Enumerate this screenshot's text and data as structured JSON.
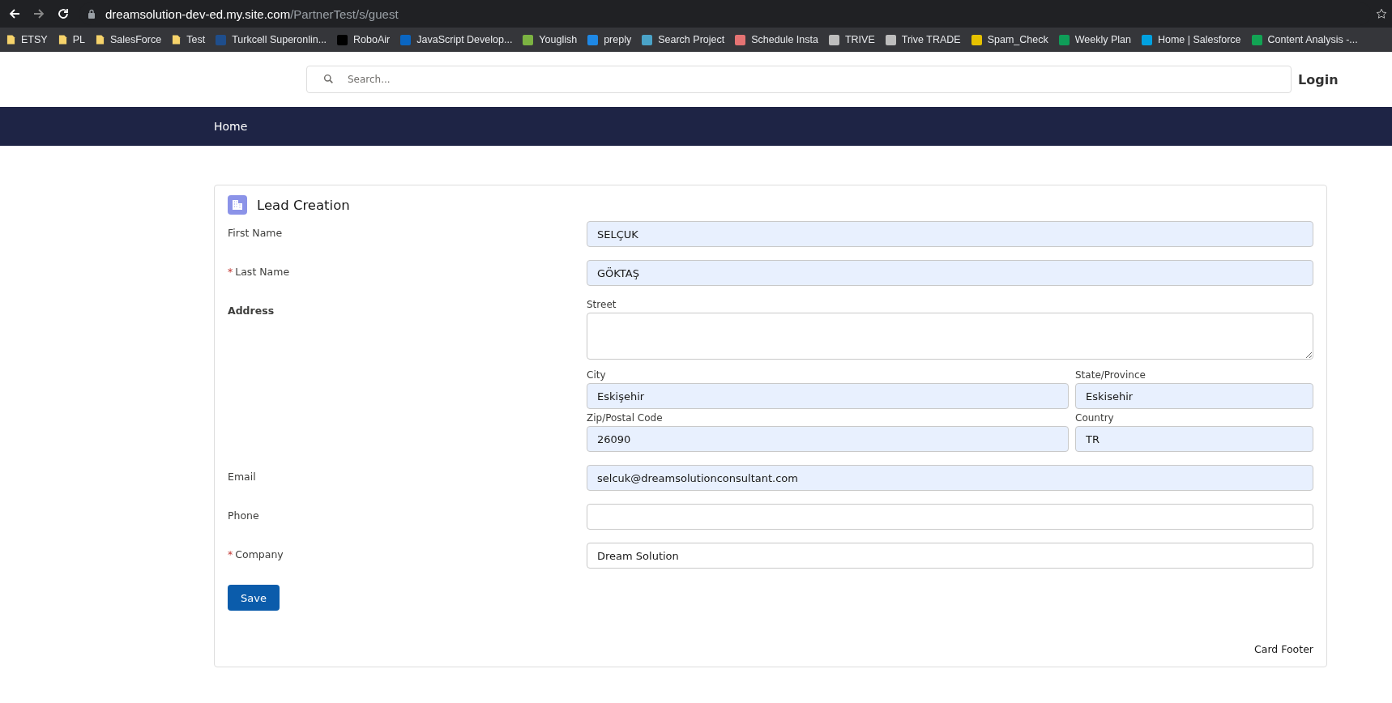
{
  "browser": {
    "url_host": "dreamsolution-dev-ed.my.site.com",
    "url_path": "/PartnerTest/s/guest",
    "bookmarks": [
      {
        "label": "ETSY",
        "kind": "folder"
      },
      {
        "label": "PL",
        "kind": "folder"
      },
      {
        "label": "SalesForce",
        "kind": "folder"
      },
      {
        "label": "Test",
        "kind": "folder"
      },
      {
        "label": "Turkcell Superonlin...",
        "kind": "site",
        "color": "#1f4e8c"
      },
      {
        "label": "RoboAir",
        "kind": "site",
        "color": "#000000"
      },
      {
        "label": "JavaScript Develop...",
        "kind": "site",
        "color": "#0a66c2"
      },
      {
        "label": "Youglish",
        "kind": "site",
        "color": "#7cb342"
      },
      {
        "label": "preply",
        "kind": "site",
        "color": "#1e88e5"
      },
      {
        "label": "Search Project",
        "kind": "site",
        "color": "#4aa3c8"
      },
      {
        "label": "Schedule Insta",
        "kind": "site",
        "color": "#e57373"
      },
      {
        "label": "TRIVE",
        "kind": "site",
        "color": "#bdbdbd"
      },
      {
        "label": "Trive TRADE",
        "kind": "site",
        "color": "#bdbdbd"
      },
      {
        "label": "Spam_Check",
        "kind": "site",
        "color": "#e6c200"
      },
      {
        "label": "Weekly Plan",
        "kind": "site",
        "color": "#0f9d58"
      },
      {
        "label": "Home | Salesforce",
        "kind": "site",
        "color": "#00a1e0"
      },
      {
        "label": "Content Analysis -...",
        "kind": "site",
        "color": "#12a454"
      }
    ]
  },
  "header": {
    "search": {
      "placeholder": "Search..."
    },
    "login": "Login"
  },
  "nav": {
    "items": [
      {
        "label": "Home"
      }
    ]
  },
  "card": {
    "title": "Lead Creation",
    "required_mark": "*",
    "footer": "Card Footer",
    "save": "Save",
    "fields": [
      {
        "kind": "text",
        "label": "First Name",
        "required": false,
        "value": "SELÇUK",
        "autofilled": true
      },
      {
        "kind": "text",
        "label": "Last Name",
        "required": true,
        "value": "GÖKTAŞ",
        "autofilled": true
      },
      {
        "kind": "address",
        "label": "Address",
        "street_label": "Street",
        "parts": [
          {
            "label": "City",
            "value": "Eskişehir",
            "autofilled": true
          },
          {
            "label": "State/Province",
            "value": "Eskisehir",
            "autofilled": true
          },
          {
            "label": "Zip/Postal Code",
            "value": "26090",
            "autofilled": true
          },
          {
            "label": "Country",
            "value": "TR",
            "autofilled": true
          }
        ]
      },
      {
        "kind": "text",
        "label": "Email",
        "required": false,
        "value": "selcuk@dreamsolutionconsultant.com",
        "autofilled": true
      },
      {
        "kind": "text",
        "label": "Phone",
        "required": false,
        "autofilled": false
      },
      {
        "kind": "text",
        "label": "Company",
        "required": true,
        "value": "Dream Solution",
        "autofilled": false
      }
    ]
  }
}
